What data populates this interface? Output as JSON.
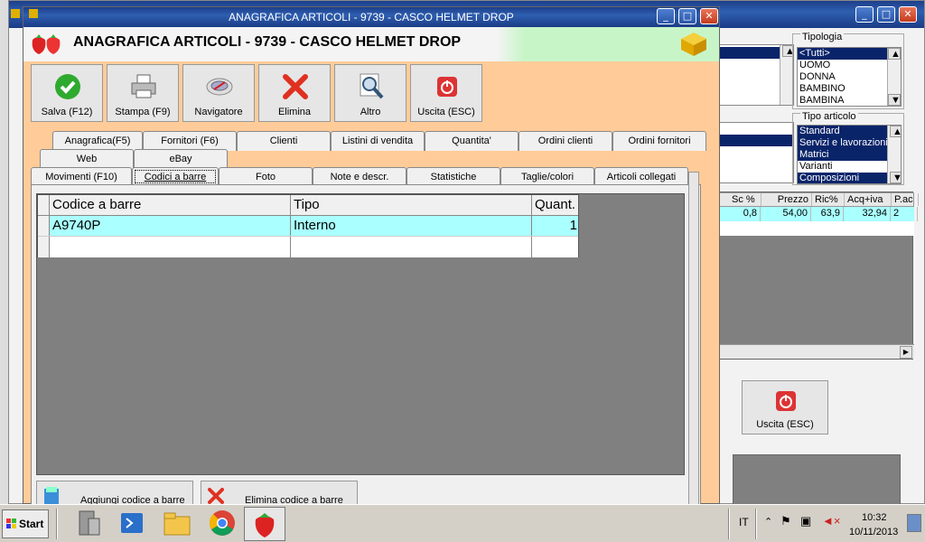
{
  "background_window": {
    "tipologia_label": "Tipologia",
    "tipologia_items": [
      "<Tutti>",
      "UOMO",
      "DONNA",
      "BAMBINO",
      "BAMBINA"
    ],
    "tipo_articolo_label": "Tipo articolo",
    "tipo_articolo_items": [
      "Standard",
      "Servizi e lavorazioni",
      "Matrici",
      "Varianti",
      "Composizioni"
    ],
    "grid_headers": [
      "Sc %",
      "Prezzo",
      "Ric%",
      "Acq+iva",
      "P.ac"
    ],
    "grid_row": [
      "0,8",
      "54,00",
      "63,9",
      "32,94",
      "2"
    ],
    "exit_button_label": "Uscita (ESC)"
  },
  "dialog": {
    "title": "ANAGRAFICA ARTICOLI - 9739 - CASCO HELMET DROP",
    "header_text": "ANAGRAFICA ARTICOLI - 9739 - CASCO HELMET DROP",
    "toolbar": [
      {
        "label": "Salva (F12)",
        "icon": "check-icon"
      },
      {
        "label": "Stampa (F9)",
        "icon": "printer-icon"
      },
      {
        "label": "Navigatore",
        "icon": "compass-icon"
      },
      {
        "label": "Elimina",
        "icon": "delete-x-icon"
      },
      {
        "label": "Altro",
        "icon": "magnifier-icon"
      },
      {
        "label": "Uscita (ESC)",
        "icon": "power-icon"
      }
    ],
    "tabs_row1": [
      "Anagrafica(F5)",
      "Fornitori (F6)",
      "Clienti",
      "Listini di vendita",
      "Quantita'",
      "Ordini clienti",
      "Ordini fornitori"
    ],
    "tabs_row2": [
      "Web",
      "eBay"
    ],
    "tabs_row3": [
      "Movimenti (F10)",
      "Codici a barre",
      "Foto",
      "Note e descr.",
      "Statistiche",
      "Taglie/colori",
      "Articoli collegati"
    ],
    "barcode_grid": {
      "headers": [
        "Codice a barre",
        "Tipo",
        "Quant."
      ],
      "rows": [
        {
          "code": "A9740P",
          "tipo": "Interno",
          "quant": "1"
        }
      ]
    },
    "bottom_buttons": [
      "Aggiungi codice a barre",
      "Elimina codice a barre"
    ]
  },
  "taskbar": {
    "start_label": "Start",
    "language": "IT",
    "time": "10:32",
    "date": "10/11/2013"
  }
}
